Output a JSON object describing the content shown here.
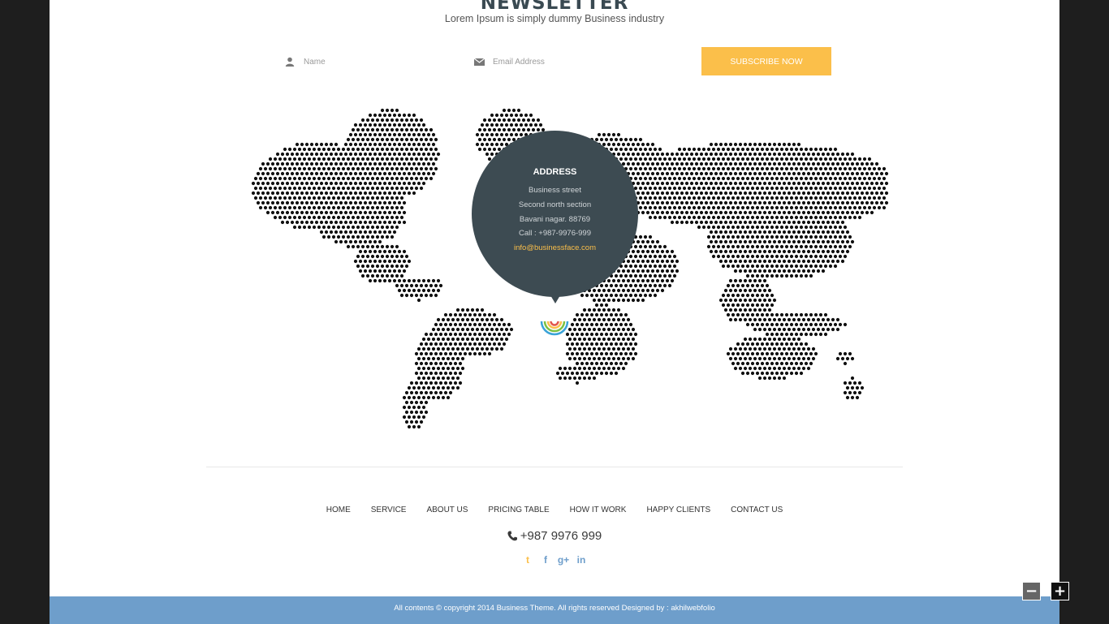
{
  "newsletter": {
    "title": "NEWSLETTER",
    "subtitle": "Lorem Ipsum is simply dummy Business industry",
    "name_placeholder": "Name",
    "email_placeholder": "Email Address",
    "subscribe_label": "SUBSCRIBE NOW"
  },
  "address": {
    "title": "ADDRESS",
    "line1": "Business street",
    "line2": "Second north section",
    "line3": "Bavani nagar. 88769",
    "call": "Call : +987-9976-999",
    "email": "info@businessface.com"
  },
  "nav": [
    "HOME",
    "SERVICE",
    "ABOUT US",
    "PRICING TABLE",
    "HOW IT WORK",
    "HAPPY CLIENTS",
    "CONTACT US"
  ],
  "phone": "+987 9976 999",
  "social": [
    {
      "icon": "twitter-icon",
      "glyph": "t",
      "color": "#fbbf4a"
    },
    {
      "icon": "facebook-icon",
      "glyph": "f",
      "color": "#6e9ecb"
    },
    {
      "icon": "google-plus-icon",
      "glyph": "g+",
      "color": "#6e9ecb"
    },
    {
      "icon": "linkedin-icon",
      "glyph": "in",
      "color": "#6e9ecb"
    }
  ],
  "footer": {
    "copyright": "All contents © copyright 2014 Business Theme. All rights reserved Designed by : akhilwebfolio"
  },
  "zoom": {
    "out_label": "−",
    "in_label": "+"
  },
  "colors": {
    "accent": "#fbbf4a",
    "bubble": "#3d4b52",
    "footer": "#6e9ecb"
  }
}
